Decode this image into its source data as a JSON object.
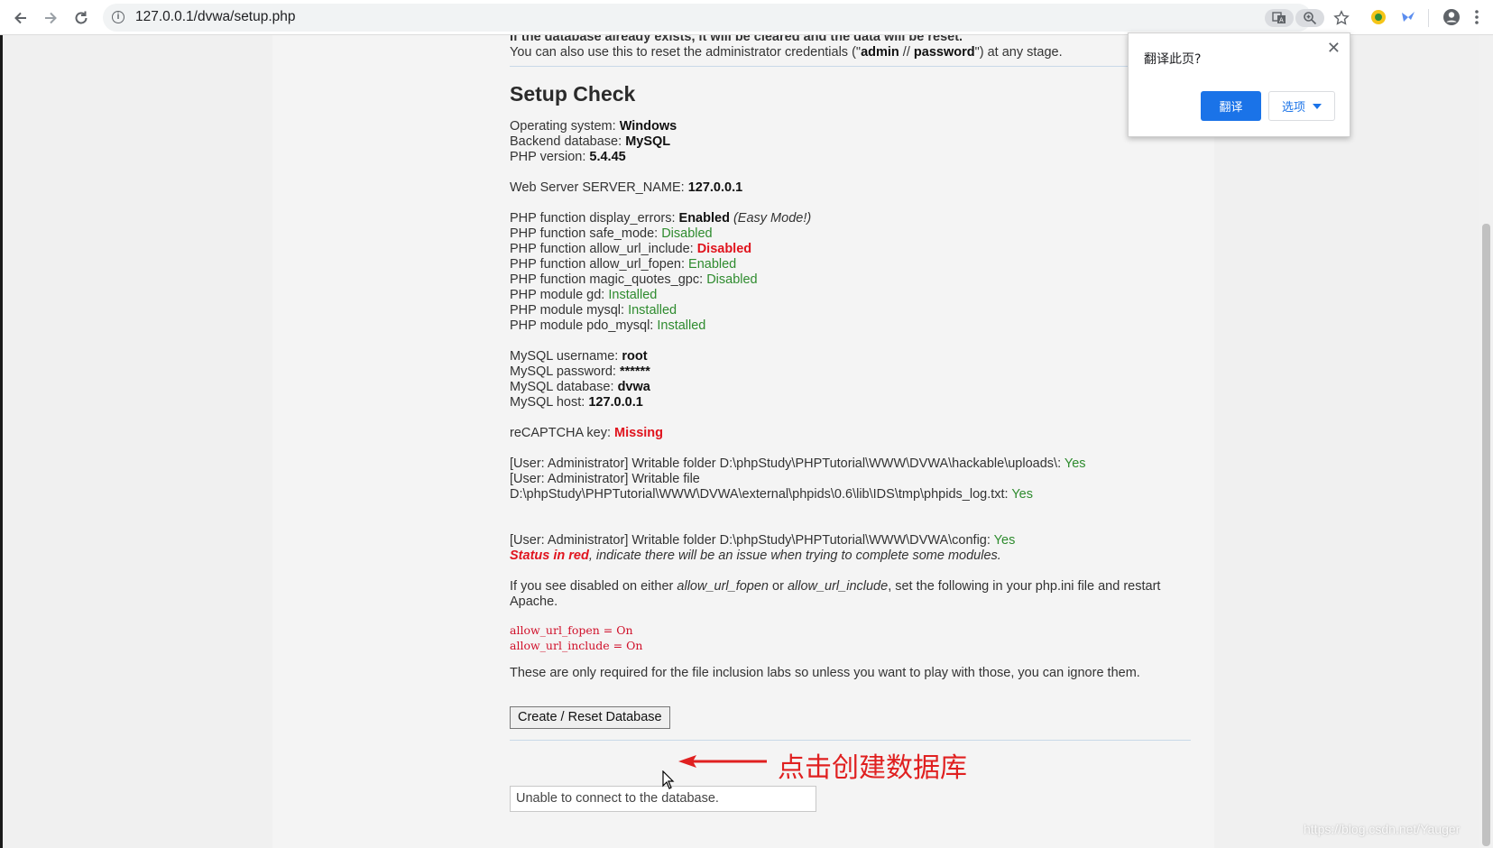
{
  "browser": {
    "url": "127.0.0.1/dvwa/setup.php",
    "icons": {
      "back": "back-arrow-icon",
      "forward": "forward-arrow-icon",
      "reload": "reload-icon",
      "info": "info-icon",
      "translate": "translate-icon",
      "zoom": "zoom-icon",
      "bookmark": "star-icon",
      "profile": "profile-icon",
      "menu": "kebab-menu-icon"
    }
  },
  "page": {
    "intro_cut": "If the database already exists, it will be cleared and the data will be reset.",
    "reset_text_a": "You can also use this to reset the administrator credentials (\"",
    "reset_user": "admin",
    "reset_sep": " // ",
    "reset_pass": "password",
    "reset_text_b": "\") at any stage.",
    "heading": "Setup Check",
    "os_label": "Operating system: ",
    "os_value": "Windows",
    "db_label": "Backend database: ",
    "db_value": "MySQL",
    "php_label": "PHP version: ",
    "php_value": "5.4.45",
    "server_label": "Web Server SERVER_NAME: ",
    "server_value": "127.0.0.1",
    "functions": [
      {
        "label": "PHP function display_errors: ",
        "value": "Enabled",
        "extra": "(Easy Mode!)"
      },
      {
        "label": "PHP function safe_mode: ",
        "value": "Disabled"
      },
      {
        "label": "PHP function allow_url_include: ",
        "value": "Disabled"
      },
      {
        "label": "PHP function allow_url_fopen: ",
        "value": "Enabled"
      },
      {
        "label": "PHP function magic_quotes_gpc: ",
        "value": "Disabled"
      },
      {
        "label": "PHP module gd: ",
        "value": "Installed"
      },
      {
        "label": "PHP module mysql: ",
        "value": "Installed"
      },
      {
        "label": "PHP module pdo_mysql: ",
        "value": "Installed"
      }
    ],
    "mysql": [
      {
        "label": "MySQL username: ",
        "value": "root"
      },
      {
        "label": "MySQL password: ",
        "value": "******"
      },
      {
        "label": "MySQL database: ",
        "value": "dvwa"
      },
      {
        "label": "MySQL host: ",
        "value": "127.0.0.1"
      }
    ],
    "recaptcha_label": "reCAPTCHA key: ",
    "recaptcha_value": "Missing",
    "writable_1_label": "[User: Administrator] Writable folder D:\\phpStudy\\PHPTutorial\\WWW\\DVWA\\hackable\\uploads\\: ",
    "writable_1_value": "Yes",
    "writable_2_line1": "[User: Administrator] Writable file",
    "writable_2_label": "D:\\phpStudy\\PHPTutorial\\WWW\\DVWA\\external\\phpids\\0.6\\lib\\IDS\\tmp\\phpids_log.txt: ",
    "writable_2_value": "Yes",
    "writable_3_label": "[User: Administrator] Writable folder D:\\phpStudy\\PHPTutorial\\WWW\\DVWA\\config: ",
    "writable_3_value": "Yes",
    "status_red_bold": "Status in red",
    "status_red_rest": ", indicate there will be an issue when trying to complete some modules.",
    "disabled_a": "If you see disabled on either ",
    "disabled_fopen": "allow_url_fopen",
    "disabled_or": " or ",
    "disabled_include": "allow_url_include",
    "disabled_b": ", set the following in your php.ini file and restart Apache.",
    "code_1": "allow_url_fopen = On",
    "code_2": "allow_url_include = On",
    "required_note": "These are only required for the file inclusion labs so unless you want to play with those, you can ignore them.",
    "create_button": "Create / Reset Database",
    "annotation": "点击创建数据库",
    "message": "Unable to connect to the database."
  },
  "translate_popup": {
    "title": "翻译此页?",
    "translate_button": "翻译",
    "options_button": "选项",
    "close": "✕"
  },
  "watermark": "https://blog.csdn.net/Yauger",
  "colors": {
    "accent_blue": "#1a73e8",
    "status_green": "#2e8b2e",
    "status_red": "#e0141e",
    "annotation_red": "#e02020"
  }
}
